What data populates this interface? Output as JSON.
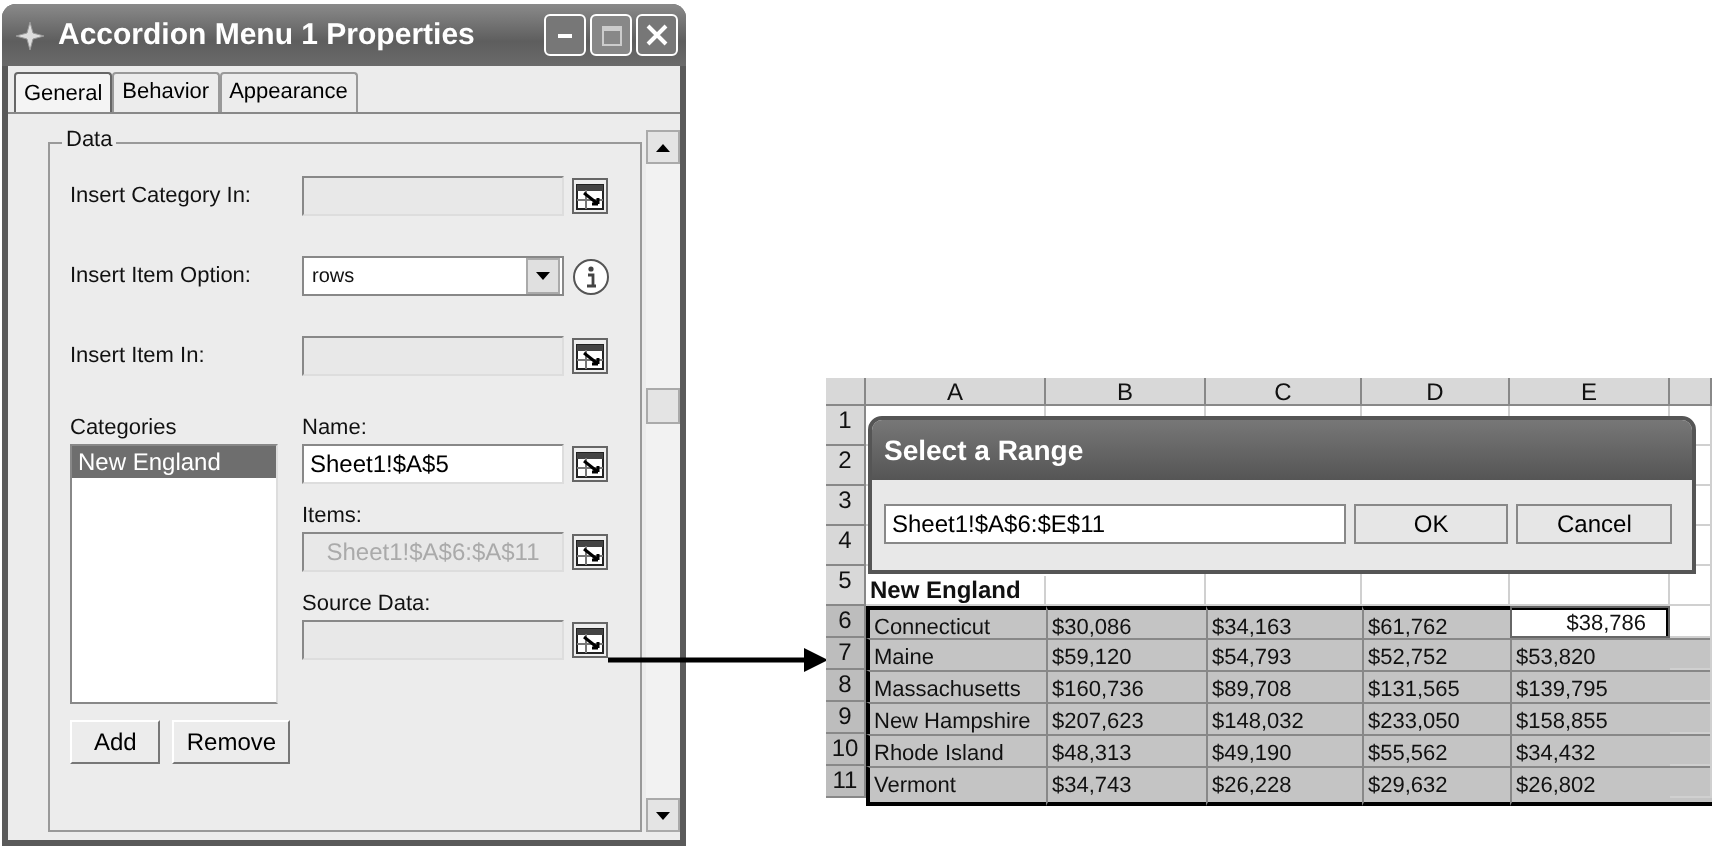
{
  "properties_window": {
    "title": "Accordion Menu 1 Properties",
    "tabs": [
      {
        "label": "General",
        "selected": true
      },
      {
        "label": "Behavior",
        "selected": false
      },
      {
        "label": "Appearance",
        "selected": false
      }
    ],
    "group_label": "Data",
    "fields": [
      {
        "label": "Insert Category In:",
        "kind": "range",
        "disabled": true
      },
      {
        "label": "Insert Item Option:",
        "kind": "select",
        "value": "rows",
        "disabled": false
      },
      {
        "label": "Insert Item In:",
        "kind": "range",
        "disabled": true
      }
    ],
    "categories": {
      "label": "Categories",
      "items": [
        {
          "label": "New England",
          "selected": true
        }
      ]
    },
    "detail_fields": [
      {
        "label": "Name:",
        "kind": "range",
        "value": "Sheet1!$A$5",
        "disabled": false
      },
      {
        "label": "Items:",
        "kind": "range",
        "value": "Sheet1!$A$6:$A$11",
        "disabled": true
      },
      {
        "label": "Source Data:",
        "kind": "range",
        "disabled": true
      }
    ],
    "buttons": [
      "Add",
      "Remove"
    ]
  },
  "spreadsheet": {
    "columns": [
      "A",
      "B",
      "C",
      "D",
      "E"
    ],
    "rows": [
      {
        "number": "1",
        "kind": "empty",
        "selected": false,
        "cells": []
      },
      {
        "number": "2",
        "kind": "empty",
        "selected": false,
        "cells": []
      },
      {
        "number": "3",
        "kind": "empty",
        "selected": false,
        "cells": []
      },
      {
        "number": "4",
        "kind": "empty",
        "selected": false,
        "cells": []
      },
      {
        "number": "5",
        "kind": "heading",
        "selected": false,
        "cells": [
          {
            "text": "New England",
            "active": false
          }
        ]
      },
      {
        "number": "6",
        "kind": "data",
        "selected": true,
        "cells": [
          {
            "text": "Connecticut",
            "active": false
          },
          {
            "text": "$30,086",
            "active": false
          },
          {
            "text": "$34,163",
            "active": false
          },
          {
            "text": "$61,762",
            "active": false
          },
          {
            "text": "$38,786",
            "active": true
          }
        ]
      },
      {
        "number": "7",
        "kind": "data",
        "selected": true,
        "cells": [
          {
            "text": "Maine",
            "active": false
          },
          {
            "text": "$59,120",
            "active": false
          },
          {
            "text": "$54,793",
            "active": false
          },
          {
            "text": "$52,752",
            "active": false
          },
          {
            "text": "$53,820",
            "active": false
          }
        ]
      },
      {
        "number": "8",
        "kind": "data",
        "selected": true,
        "cells": [
          {
            "text": "Massachusetts",
            "active": false
          },
          {
            "text": "$160,736",
            "active": false
          },
          {
            "text": "$89,708",
            "active": false
          },
          {
            "text": "$131,565",
            "active": false
          },
          {
            "text": "$139,795",
            "active": false
          }
        ]
      },
      {
        "number": "9",
        "kind": "data",
        "selected": true,
        "cells": [
          {
            "text": "New Hampshire",
            "active": false
          },
          {
            "text": "$207,623",
            "active": false
          },
          {
            "text": "$148,032",
            "active": false
          },
          {
            "text": "$233,050",
            "active": false
          },
          {
            "text": "$158,855",
            "active": false
          }
        ]
      },
      {
        "number": "10",
        "kind": "data",
        "selected": true,
        "cells": [
          {
            "text": "Rhode Island",
            "active": false
          },
          {
            "text": "$48,313",
            "active": false
          },
          {
            "text": "$49,190",
            "active": false
          },
          {
            "text": "$55,562",
            "active": false
          },
          {
            "text": "$34,432",
            "active": false
          }
        ]
      },
      {
        "number": "11",
        "kind": "data",
        "selected": true,
        "cells": [
          {
            "text": "Vermont",
            "active": false
          },
          {
            "text": "$34,743",
            "active": false
          },
          {
            "text": "$26,228",
            "active": false
          },
          {
            "text": "$29,632",
            "active": false
          },
          {
            "text": "$26,802",
            "active": false
          }
        ]
      }
    ]
  },
  "range_dialog": {
    "title": "Select a Range",
    "value": "Sheet1!$A$6:$E$11",
    "buttons": [
      "OK",
      "Cancel"
    ]
  }
}
